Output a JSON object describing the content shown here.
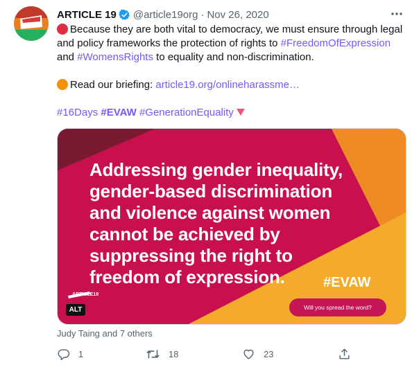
{
  "tweet": {
    "display_name": "ARTICLE 19",
    "handle": "@article19org",
    "separator": "·",
    "date": "Nov 26, 2020",
    "avatar_logo_text": "ARTICLE 19",
    "line1_a": "Because they are both vital to democracy, we must ensure through legal",
    "line2_a": "and policy frameworks the protection of rights to ",
    "hashtag_freedom": "#FreedomOfExpression",
    "line3_a": "and ",
    "hashtag_women": "#WomensRights",
    "line3_b": " to equality and non-discrimination.",
    "line4_a": "Read our briefing: ",
    "briefing_link": "article19.org/onlineharassme…",
    "hashtag_16days": "#16Days",
    "hashtag_evaw": "#EVAW",
    "hashtag_ge": "#GenerationEquality",
    "colors": {
      "red_circle": "#dd2e44",
      "orange_circle": "#f4900c",
      "hashtag": "#7856ff",
      "triangle": "#f0557a"
    }
  },
  "media": {
    "headline_lines": [
      "Addressing gender inequality,",
      "gender-based discrimination",
      "and violence against women",
      "cannot be achieved by",
      "suppressing the right to",
      "freedom of expression."
    ],
    "evaw_tag": "#EVAW",
    "spread_button": "Will you spread the word?",
    "logo_text": "ARTICLE19",
    "alt_badge": "ALT",
    "colors": {
      "magenta": "#c8104f",
      "dark_red": "#7a1a30",
      "orange": "#f08a24",
      "yellow": "#f4aa2a"
    }
  },
  "tagged": "Judy Taing and 7 others",
  "actions": {
    "reply_count": "1",
    "retweet_count": "18",
    "like_count": "23"
  }
}
